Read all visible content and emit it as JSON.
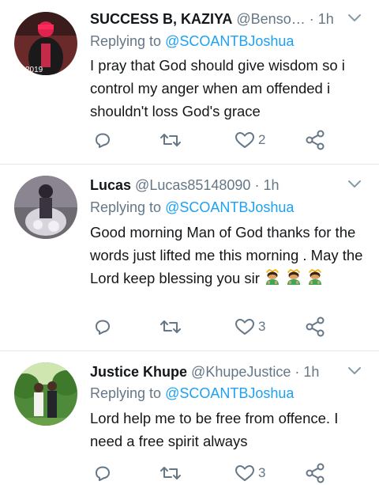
{
  "tweets": [
    {
      "name": "SUCCESS B, KAZIYA",
      "handle": "@Benso…",
      "sep": "·",
      "time": "1h",
      "reply_prefix": "Replying to",
      "reply_to": "@SCOANTBJoshua",
      "text": "I pray that God should give wisdom so  i control my anger when am offended i shouldn't loss God's grace",
      "emoji_count": 0,
      "emoji_name": "",
      "likes": "2",
      "avatar_label": "2019"
    },
    {
      "name": "Lucas",
      "handle": "@Lucas85148090",
      "sep": "·",
      "time": "1h",
      "reply_prefix": "Replying to",
      "reply_to": "@SCOANTBJoshua",
      "text": "Good morning Man of God thanks for the words just lifted me this morning . May the Lord keep blessing you sir",
      "emoji_count": 3,
      "emoji_name": "man-bowing-emoji",
      "likes": "3"
    },
    {
      "name": "Justice Khupe",
      "handle": "@KhupeJustice",
      "sep": "·",
      "time": "1h",
      "reply_prefix": "Replying to",
      "reply_to": "@SCOANTBJoshua",
      "text": "Lord help me to be free from offence. I need a free spirit always",
      "emoji_count": 0,
      "emoji_name": "",
      "likes": "3"
    }
  ],
  "colors": {
    "text": "#14171a",
    "muted": "#657786",
    "link": "#1da1f2",
    "divider": "#e1e8ed"
  },
  "icons": [
    "reply-icon",
    "retweet-icon",
    "like-icon",
    "share-icon",
    "caret-down-icon"
  ]
}
